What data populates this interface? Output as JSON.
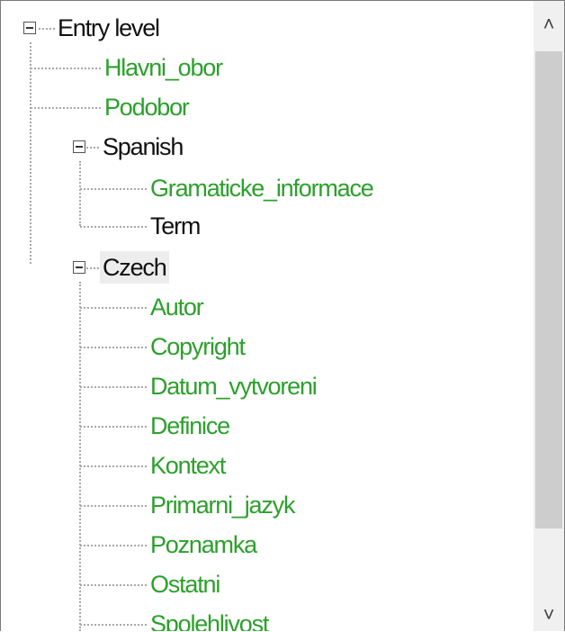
{
  "tree": {
    "root": {
      "label": "Entry level",
      "expanded": true
    },
    "children": [
      {
        "label": "Hlavni_obor",
        "color": "#2ca02c"
      },
      {
        "label": "Podobor",
        "color": "#2ca02c"
      },
      {
        "label": "Spanish",
        "expanded": true,
        "children": [
          {
            "label": "Gramaticke_informace",
            "color": "#2ca02c"
          },
          {
            "label": "Term",
            "color": "#111111"
          }
        ]
      },
      {
        "label": "Czech",
        "expanded": true,
        "selected": true,
        "children": [
          {
            "label": "Autor",
            "color": "#2ca02c"
          },
          {
            "label": "Copyright",
            "color": "#2ca02c"
          },
          {
            "label": "Datum_vytvoreni",
            "color": "#2ca02c"
          },
          {
            "label": "Definice",
            "color": "#2ca02c"
          },
          {
            "label": "Kontext",
            "color": "#2ca02c"
          },
          {
            "label": "Primarni_jazyk",
            "color": "#2ca02c"
          },
          {
            "label": "Poznamka",
            "color": "#2ca02c"
          },
          {
            "label": "Ostatni",
            "color": "#2ca02c"
          },
          {
            "label": "Spolehlivost",
            "color": "#2ca02c"
          }
        ]
      }
    ]
  },
  "scrollbar": {
    "up_icon": "chevron-up-icon",
    "down_icon": "chevron-down-icon",
    "up_glyph": "˄",
    "down_glyph": "˅"
  }
}
